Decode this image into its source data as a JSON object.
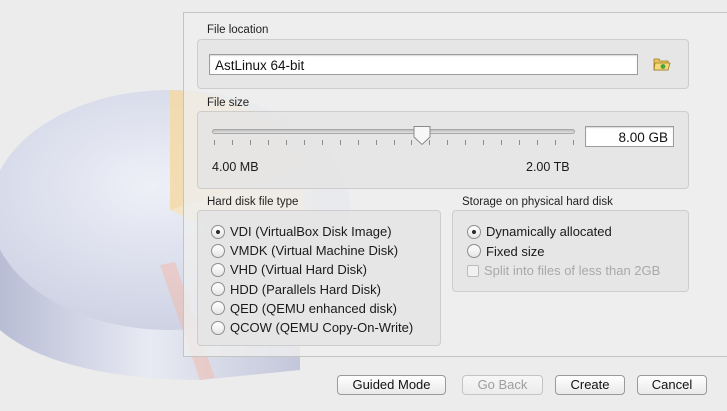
{
  "file_location": {
    "label": "File location",
    "value": "AstLinux 64-bit",
    "folder_icon": "folder-open-icon"
  },
  "file_size": {
    "label": "File size",
    "value": "8.00 GB",
    "min_label": "4.00 MB",
    "max_label": "2.00 TB",
    "slider_position": 0.58
  },
  "disk_type": {
    "label": "Hard disk file type",
    "options": [
      {
        "label": "VDI (VirtualBox Disk Image)",
        "selected": true
      },
      {
        "label": "VMDK (Virtual Machine Disk)",
        "selected": false
      },
      {
        "label": "VHD (Virtual Hard Disk)",
        "selected": false
      },
      {
        "label": "HDD (Parallels Hard Disk)",
        "selected": false
      },
      {
        "label": "QED (QEMU enhanced disk)",
        "selected": false
      },
      {
        "label": "QCOW (QEMU Copy-On-Write)",
        "selected": false
      }
    ]
  },
  "storage": {
    "label": "Storage on physical hard disk",
    "options": [
      {
        "label": "Dynamically allocated",
        "selected": true
      },
      {
        "label": "Fixed size",
        "selected": false
      }
    ],
    "split_label": "Split into files of less than 2GB",
    "split_enabled": false
  },
  "buttons": {
    "guided_mode": "Guided Mode",
    "go_back": "Go Back",
    "create": "Create",
    "cancel": "Cancel"
  },
  "colors": {
    "disk_body": "#cfd3e6",
    "disk_slice": "#f5d9a0",
    "panel_bg": "#eeeeee"
  }
}
